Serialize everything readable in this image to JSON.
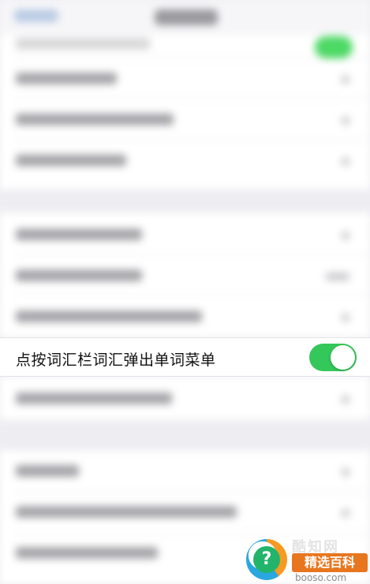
{
  "row": {
    "label": "点按词汇栏词汇弹出单词菜单",
    "toggle_on": true
  },
  "watermark": {
    "logo_text": "酷知网",
    "badge": "精选百科",
    "domain": "booso.com"
  },
  "colors": {
    "toggle_on": "#34c759",
    "background": "#f0f0f4",
    "badge": "#e8761f"
  }
}
